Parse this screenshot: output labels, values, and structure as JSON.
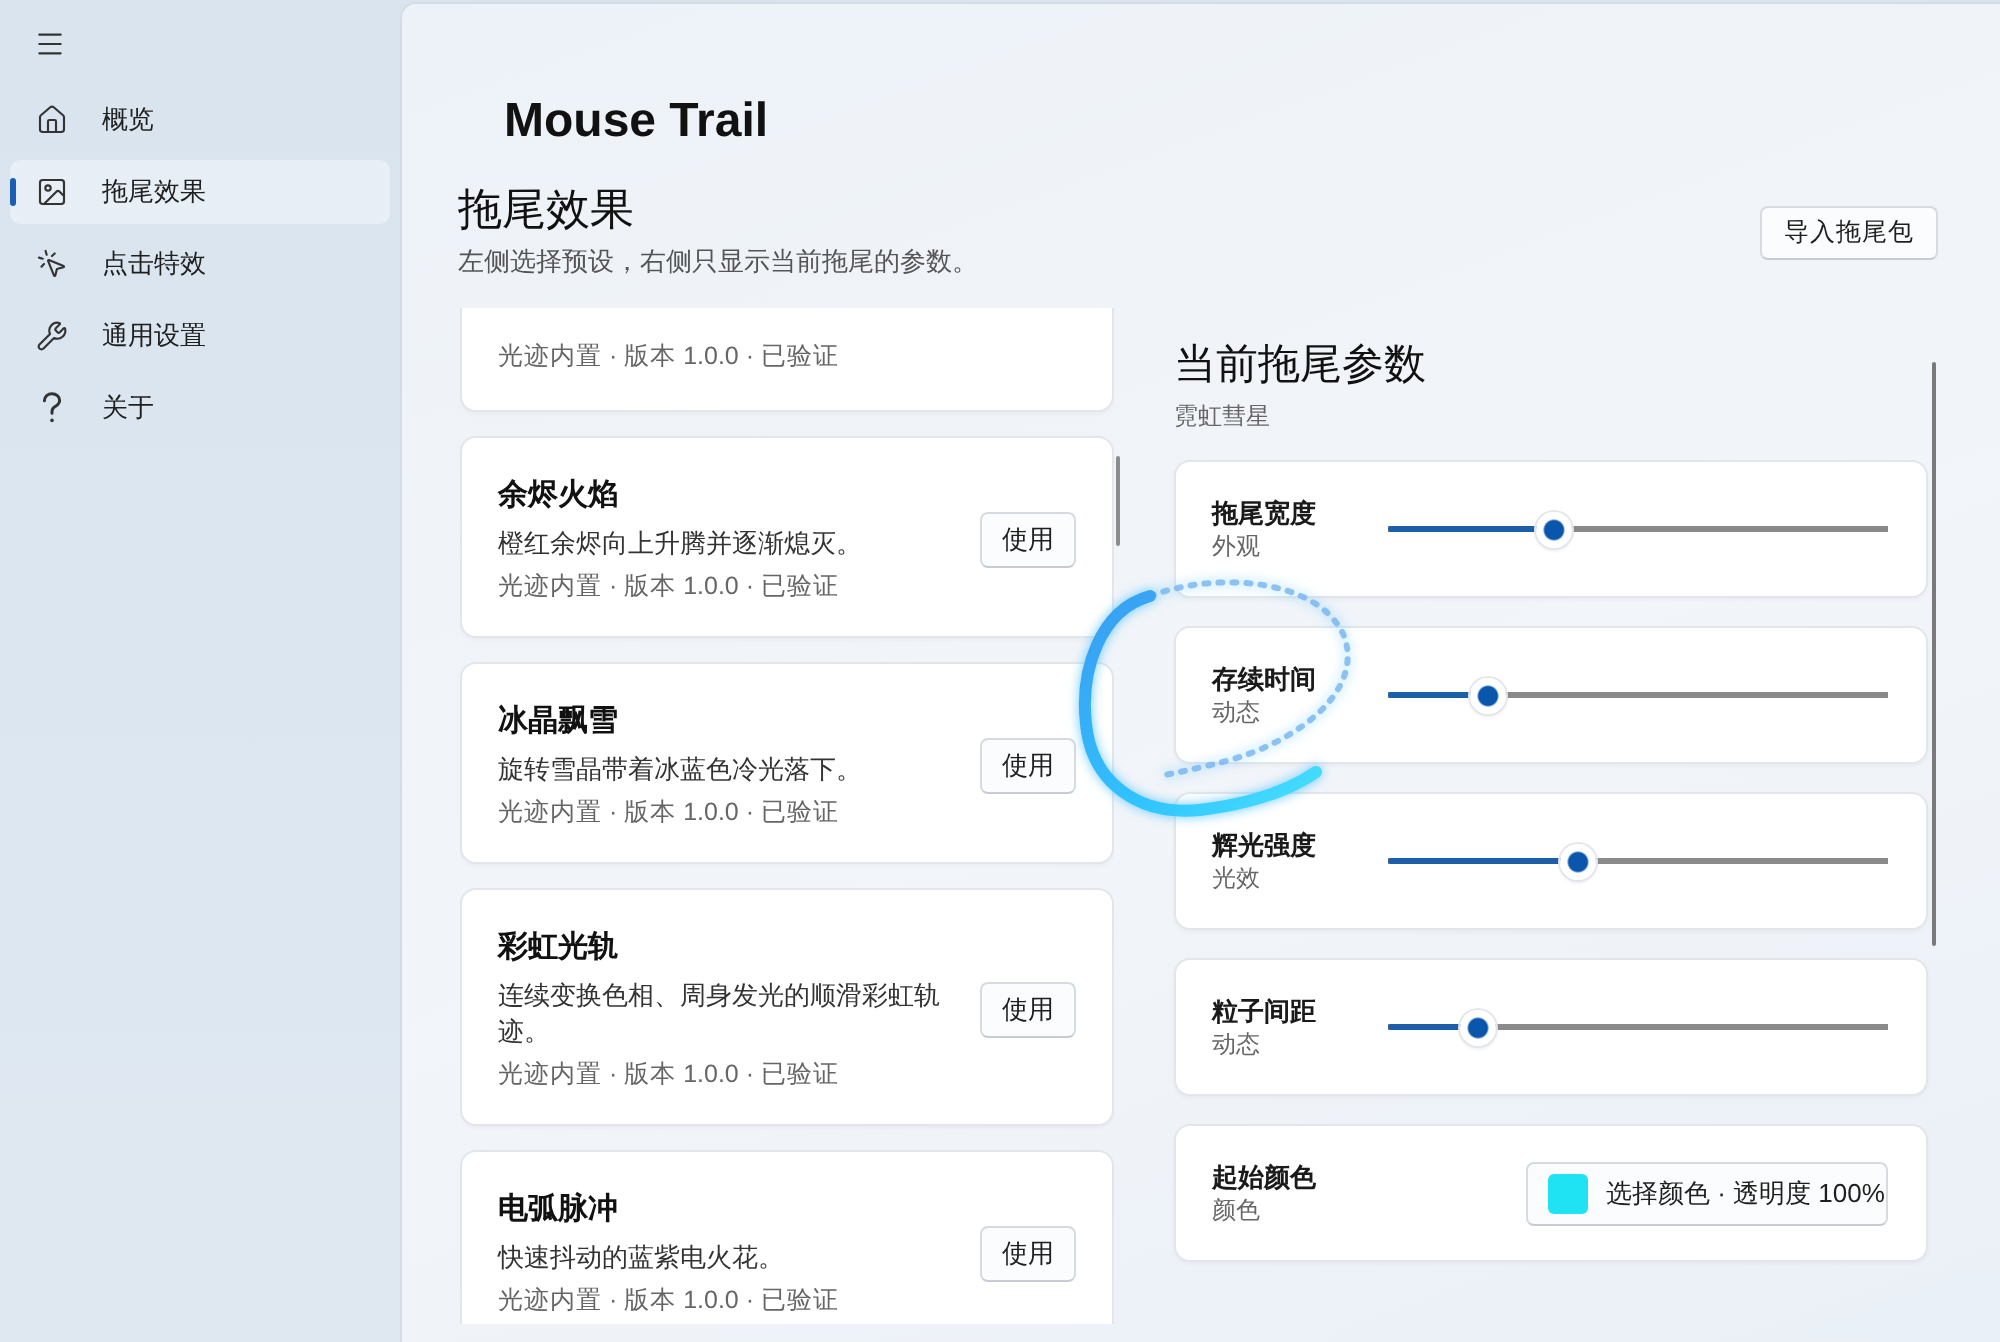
{
  "sidebar": {
    "items": [
      {
        "label": "概览",
        "selected": false
      },
      {
        "label": "拖尾效果",
        "selected": true
      },
      {
        "label": "点击特效",
        "selected": false
      },
      {
        "label": "通用设置",
        "selected": false
      },
      {
        "label": "关于",
        "selected": false
      }
    ]
  },
  "app_title": "Mouse Trail",
  "page": {
    "title": "拖尾效果",
    "subtitle": "左侧选择预设，右侧只显示当前拖尾的参数。",
    "import_button": "导入拖尾包"
  },
  "presets": [
    {
      "meta": "光迹内置 · 版本 1.0.0 · 已验证"
    },
    {
      "name": "余烬火焰",
      "description": "橙红余烬向上升腾并逐渐熄灭。",
      "meta": "光迹内置 · 版本 1.0.0 · 已验证",
      "button": "使用"
    },
    {
      "name": "冰晶飘雪",
      "description": "旋转雪晶带着冰蓝色冷光落下。",
      "meta": "光迹内置 · 版本 1.0.0 · 已验证",
      "button": "使用"
    },
    {
      "name": "彩虹光轨",
      "description": "连续变换色相、周身发光的顺滑彩虹轨迹。",
      "meta": "光迹内置 · 版本 1.0.0 · 已验证",
      "button": "使用"
    },
    {
      "name": "电弧脉冲",
      "description": "快速抖动的蓝紫电火花。",
      "meta": "光迹内置 · 版本 1.0.0 · 已验证",
      "button": "使用"
    }
  ],
  "parameters": {
    "title": "当前拖尾参数",
    "preset_name": "霓虹彗星",
    "rows": [
      {
        "kind": "slider",
        "label": "拖尾宽度",
        "category": "外观",
        "level": 0.33
      },
      {
        "kind": "slider",
        "label": "存续时间",
        "category": "动态",
        "level": 0.2
      },
      {
        "kind": "slider",
        "label": "辉光强度",
        "category": "光效",
        "level": 0.38
      },
      {
        "kind": "slider",
        "label": "粒子间距",
        "category": "动态",
        "level": 0.18
      },
      {
        "kind": "color",
        "label": "起始颜色",
        "category": "颜色",
        "color": "#1fe2f2",
        "button": "选择颜色 · 透明度 100%"
      }
    ]
  }
}
